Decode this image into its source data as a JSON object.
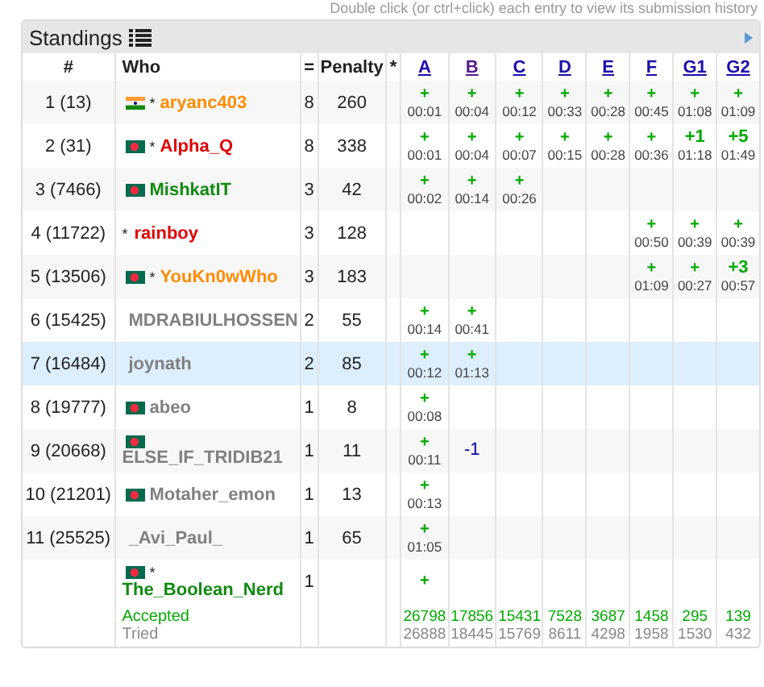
{
  "hint": "Double click (or ctrl+click) each entry to view its submission history",
  "title": "Standings",
  "columns": {
    "rank": "#",
    "who": "Who",
    "solved": "=",
    "penalty": "Penalty",
    "hacks": "*"
  },
  "problems": [
    {
      "label": "A",
      "visited": false
    },
    {
      "label": "B",
      "visited": true
    },
    {
      "label": "C",
      "visited": false
    },
    {
      "label": "D",
      "visited": false
    },
    {
      "label": "E",
      "visited": false
    },
    {
      "label": "F",
      "visited": false
    },
    {
      "label": "G1",
      "visited": false
    },
    {
      "label": "G2",
      "visited": false
    }
  ],
  "rows": [
    {
      "rank": "1 (13)",
      "flag": {
        "kind": "india"
      },
      "mark": "*",
      "handle": "aryanc403",
      "color": "#ff8c00",
      "solved": "8",
      "penalty": "260",
      "selected": false,
      "cells": [
        {
          "accepted": true,
          "verdict": "+",
          "time": "00:01"
        },
        {
          "accepted": true,
          "verdict": "+",
          "time": "00:04"
        },
        {
          "accepted": true,
          "verdict": "+",
          "time": "00:12"
        },
        {
          "accepted": true,
          "verdict": "+",
          "time": "00:33"
        },
        {
          "accepted": true,
          "verdict": "+",
          "time": "00:28"
        },
        {
          "accepted": true,
          "verdict": "+",
          "time": "00:45"
        },
        {
          "accepted": true,
          "verdict": "+",
          "time": "01:08"
        },
        {
          "accepted": true,
          "verdict": "+",
          "time": "01:09"
        }
      ]
    },
    {
      "rank": "2 (31)",
      "flag": {
        "kind": "bangladesh"
      },
      "mark": "*",
      "handle": "Alpha_Q",
      "color": "#e00000",
      "solved": "8",
      "penalty": "338",
      "selected": false,
      "cells": [
        {
          "accepted": true,
          "verdict": "+",
          "time": "00:01"
        },
        {
          "accepted": true,
          "verdict": "+",
          "time": "00:04"
        },
        {
          "accepted": true,
          "verdict": "+",
          "time": "00:07"
        },
        {
          "accepted": true,
          "verdict": "+",
          "time": "00:15"
        },
        {
          "accepted": true,
          "verdict": "+",
          "time": "00:28"
        },
        {
          "accepted": true,
          "verdict": "+",
          "time": "00:36"
        },
        {
          "accepted": true,
          "verdict": "+1",
          "time": "01:18"
        },
        {
          "accepted": true,
          "verdict": "+5",
          "time": "01:49"
        }
      ]
    },
    {
      "rank": "3 (7466)",
      "flag": {
        "kind": "bangladesh"
      },
      "handle": "MishkatIT",
      "color": "#108a10",
      "solved": "3",
      "penalty": "42",
      "selected": false,
      "cells": [
        {
          "accepted": true,
          "verdict": "+",
          "time": "00:02"
        },
        {
          "accepted": true,
          "verdict": "+",
          "time": "00:14"
        },
        {
          "accepted": true,
          "verdict": "+",
          "time": "00:26"
        },
        null,
        null,
        null,
        null,
        null
      ]
    },
    {
      "rank": "4 (11722)",
      "mark": "*",
      "handle": "rainboy",
      "color": "#e00000",
      "solved": "3",
      "penalty": "128",
      "selected": false,
      "cells": [
        null,
        null,
        null,
        null,
        null,
        {
          "accepted": true,
          "verdict": "+",
          "time": "00:50"
        },
        {
          "accepted": true,
          "verdict": "+",
          "time": "00:39"
        },
        {
          "accepted": true,
          "verdict": "+",
          "time": "00:39"
        }
      ]
    },
    {
      "rank": "5 (13506)",
      "flag": {
        "kind": "bangladesh"
      },
      "mark": "*",
      "handle": "YouKn0wWho",
      "color": "#ff8c00",
      "solved": "3",
      "penalty": "183",
      "selected": false,
      "cells": [
        null,
        null,
        null,
        null,
        null,
        {
          "accepted": true,
          "verdict": "+",
          "time": "01:09"
        },
        {
          "accepted": true,
          "verdict": "+",
          "time": "00:27"
        },
        {
          "accepted": true,
          "verdict": "+3",
          "time": "00:57"
        }
      ]
    },
    {
      "rank": "6 (15425)",
      "handle": "MDRABIULHOSSEN",
      "color": "#808080",
      "solved": "2",
      "penalty": "55",
      "selected": false,
      "cells": [
        {
          "accepted": true,
          "verdict": "+",
          "time": "00:14"
        },
        {
          "accepted": true,
          "verdict": "+",
          "time": "00:41"
        },
        null,
        null,
        null,
        null,
        null,
        null
      ]
    },
    {
      "rank": "7 (16484)",
      "handle": "joynath",
      "color": "#808080",
      "solved": "2",
      "penalty": "85",
      "selected": true,
      "cells": [
        {
          "accepted": true,
          "verdict": "+",
          "time": "00:12"
        },
        {
          "accepted": true,
          "verdict": "+",
          "time": "01:13"
        },
        null,
        null,
        null,
        null,
        null,
        null
      ]
    },
    {
      "rank": "8 (19777)",
      "flag": {
        "kind": "bangladesh"
      },
      "handle": "abeo",
      "color": "#808080",
      "solved": "1",
      "penalty": "8",
      "selected": false,
      "cells": [
        {
          "accepted": true,
          "verdict": "+",
          "time": "00:08"
        },
        null,
        null,
        null,
        null,
        null,
        null,
        null
      ]
    },
    {
      "rank": "9 (20668)",
      "flag": {
        "kind": "bangladesh"
      },
      "handle": "ELSE_IF_TRIDIB21",
      "color": "#808080",
      "solved": "1",
      "penalty": "11",
      "selected": false,
      "cells": [
        {
          "accepted": true,
          "verdict": "+",
          "time": "00:11"
        },
        {
          "accepted": false,
          "verdict": "-1"
        },
        null,
        null,
        null,
        null,
        null,
        null
      ]
    },
    {
      "rank": "10 (21201)",
      "flag": {
        "kind": "bangladesh"
      },
      "handle": "Motaher_emon",
      "color": "#808080",
      "solved": "1",
      "penalty": "13",
      "selected": false,
      "cells": [
        {
          "accepted": true,
          "verdict": "+",
          "time": "00:13"
        },
        null,
        null,
        null,
        null,
        null,
        null,
        null
      ]
    },
    {
      "rank": "11 (25525)",
      "handle": "_Avi_Paul_",
      "color": "#808080",
      "solved": "1",
      "penalty": "65",
      "selected": false,
      "cells": [
        {
          "accepted": true,
          "verdict": "+",
          "time": "01:05"
        },
        null,
        null,
        null,
        null,
        null,
        null,
        null
      ]
    },
    {
      "flag": {
        "kind": "bangladesh"
      },
      "mark": "*",
      "handle": "The_Boolean_Nerd",
      "color": "#108a10",
      "solved": "1",
      "selected": false,
      "cells": [
        {
          "accepted": true,
          "verdict": "+"
        },
        null,
        null,
        null,
        null,
        null,
        null,
        null
      ]
    }
  ],
  "totals": {
    "accepted_label": "Accepted",
    "tried_label": "Tried",
    "accepted": [
      "26798",
      "17856",
      "15431",
      "7528",
      "3687",
      "1458",
      "295",
      "139"
    ],
    "tried": [
      "26888",
      "18445",
      "15769",
      "8611",
      "4298",
      "1958",
      "1530",
      "432"
    ]
  }
}
